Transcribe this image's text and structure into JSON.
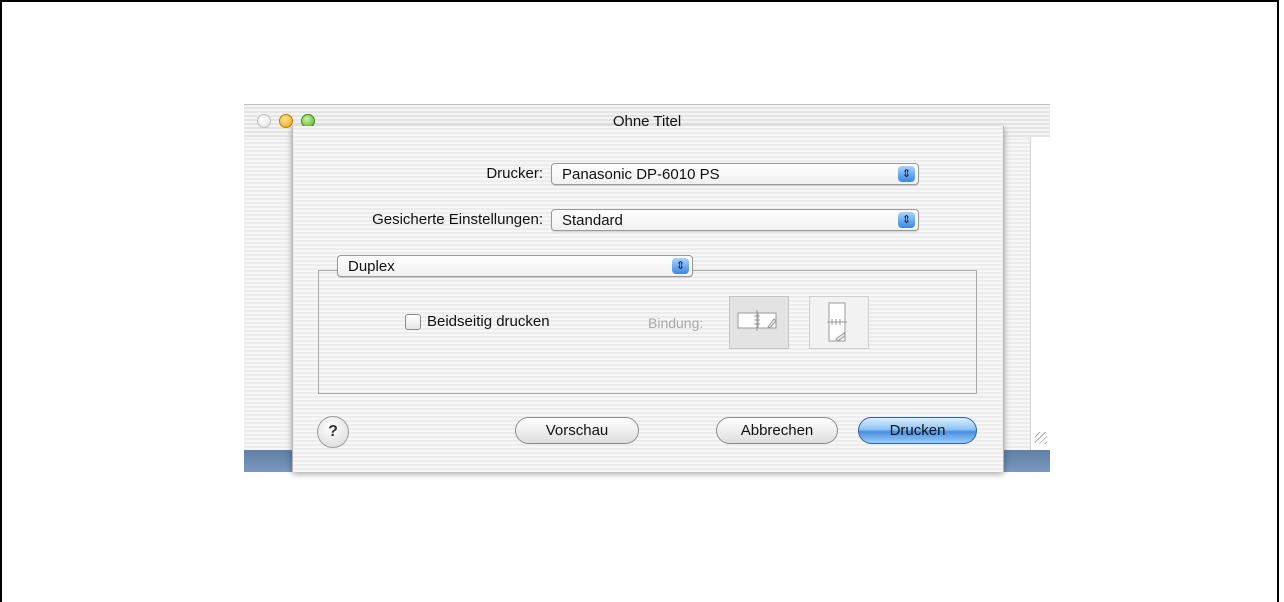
{
  "window": {
    "title": "Ohne Titel"
  },
  "print_dialog": {
    "printer": {
      "label": "Drucker:",
      "value": "Panasonic DP-6010 PS"
    },
    "presets": {
      "label": "Gesicherte Einstellungen:",
      "value": "Standard"
    },
    "panel": {
      "value": "Duplex"
    },
    "duplex": {
      "checkbox_label": "Beidseitig drucken",
      "checked": false,
      "binding_label": "Bindung:"
    },
    "help_label": "?",
    "buttons": {
      "preview": "Vorschau",
      "cancel": "Abbrechen",
      "print": "Drucken"
    }
  },
  "icons": {
    "popup_arrows": "⇕",
    "long_edge_binding": "long-edge-binding-icon",
    "short_edge_binding": "short-edge-binding-icon"
  },
  "colors": {
    "accent": "#4a90e2",
    "window_bottom": "#6e8cb3"
  }
}
